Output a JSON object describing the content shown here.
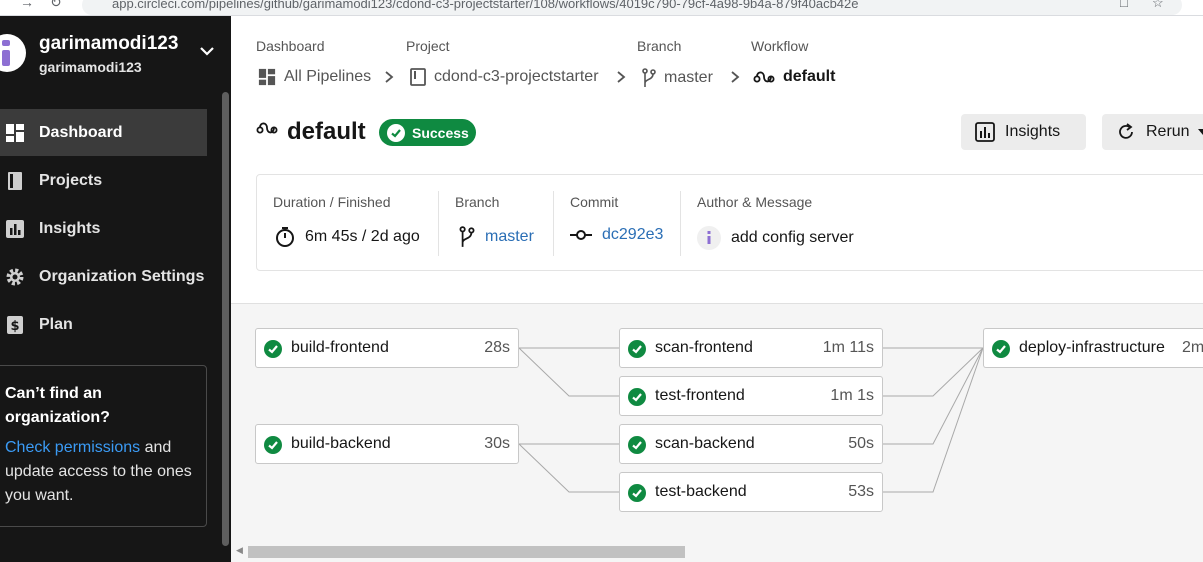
{
  "browser": {
    "url": "app.circleci.com/pipelines/github/garimamodi123/cdond-c3-projectstarter/108/workflows/4019c790-79cf-4a98-9b4a-879f40acb42e"
  },
  "sidebar": {
    "user": {
      "name": "garimamodi123",
      "org": "garimamodi123"
    },
    "items": [
      {
        "label": "Dashboard",
        "icon": "dashboard-icon",
        "active": true
      },
      {
        "label": "Projects",
        "icon": "projects-icon",
        "active": false
      },
      {
        "label": "Insights",
        "icon": "insights-icon",
        "active": false
      },
      {
        "label": "Organization Settings",
        "icon": "gear-icon",
        "active": false
      },
      {
        "label": "Plan",
        "icon": "plan-icon",
        "active": false
      }
    ],
    "help": {
      "title": "Can’t find an organization?",
      "link": "Check permissions",
      "rest": " and update access to the ones you want."
    }
  },
  "breadcrumb": {
    "dashboard": {
      "heading": "Dashboard",
      "value": "All Pipelines"
    },
    "project": {
      "heading": "Project",
      "value": "cdond-c3-projectstarter"
    },
    "branch": {
      "heading": "Branch",
      "value": "master"
    },
    "workflow": {
      "heading": "Workflow",
      "value": "default"
    }
  },
  "workflow": {
    "title": "default",
    "status": "Success",
    "status_color": "#0f8a41",
    "insights_label": "Insights",
    "rerun_label": "Rerun"
  },
  "info": {
    "duration_label": "Duration / Finished",
    "duration_value": "6m 45s / 2d ago",
    "branch_label": "Branch",
    "branch_value": "master",
    "commit_label": "Commit",
    "commit_value": "dc292e3",
    "author_label": "Author & Message",
    "message": "add config server"
  },
  "jobs": {
    "build_frontend": {
      "name": "build-frontend",
      "duration": "28s"
    },
    "build_backend": {
      "name": "build-backend",
      "duration": "30s"
    },
    "scan_frontend": {
      "name": "scan-frontend",
      "duration": "1m 11s"
    },
    "test_frontend": {
      "name": "test-frontend",
      "duration": "1m 1s"
    },
    "scan_backend": {
      "name": "scan-backend",
      "duration": "50s"
    },
    "test_backend": {
      "name": "test-backend",
      "duration": "53s"
    },
    "deploy_infrastructure": {
      "name": "deploy-infrastructure",
      "duration": "2m"
    }
  }
}
